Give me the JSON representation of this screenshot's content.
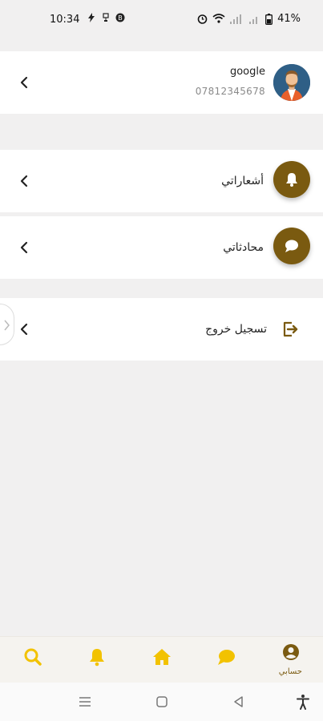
{
  "status_bar": {
    "time": "10:34",
    "battery": "41%"
  },
  "profile": {
    "name": "google",
    "phone": "07812345678"
  },
  "menu": {
    "notifications_label": "أشعاراتي",
    "chats_label": "محادثاتي",
    "logout_label": "تسجيل خروج"
  },
  "bottom_nav": {
    "account_label": "حسابي",
    "icons": [
      "search-icon",
      "bell-icon",
      "home-icon",
      "chat-icon",
      "account-icon"
    ],
    "active_color": "#7a5a10",
    "icon_color": "#f2c200"
  },
  "colors": {
    "accent": "#7a5a10",
    "nav_yellow": "#f2c200",
    "background": "#f1f0f0"
  }
}
